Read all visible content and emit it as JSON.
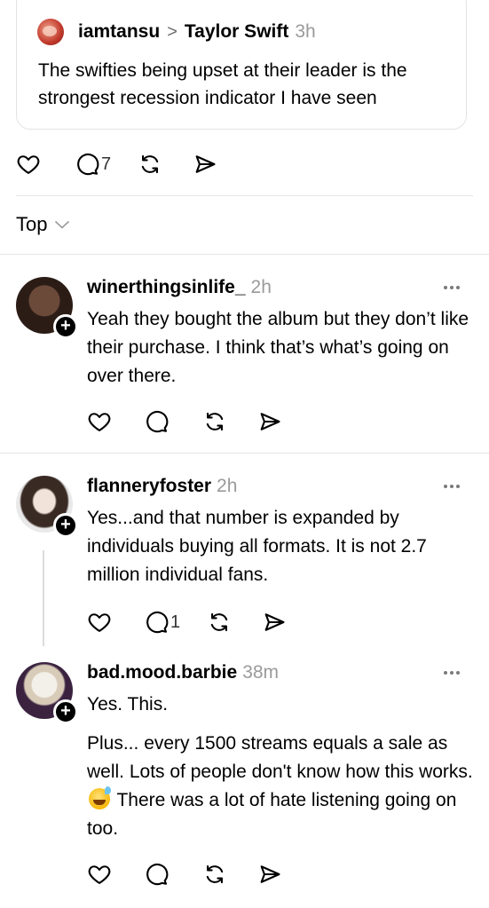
{
  "quote": {
    "username": "iamtansu",
    "separator": ">",
    "target": "Taylor Swift",
    "time": "3h",
    "text": "The swifties being upset at their leader is the strongest recession indicator I have seen"
  },
  "main_actions": {
    "replies_count": "7"
  },
  "sort": {
    "label": "Top"
  },
  "replies": [
    {
      "username": "winerthingsinlife_",
      "time": "2h",
      "text": "Yeah they bought the album but they don’t like their purchase. I think that’s what’s going on over there.",
      "replies_count": ""
    },
    {
      "username": "flanneryfoster",
      "time": "2h",
      "text": "Yes...and that number is expanded by individuals buying all formats. It is not 2.7 million individual fans.",
      "replies_count": "1"
    },
    {
      "username": "bad.mood.barbie",
      "time": "38m",
      "text_line1": "Yes. This.",
      "text_p2_a": "Plus... every 1500 streams equals a sale as well. Lots of people don't know how this works.",
      "text_p2_b": "There was a lot of hate listening going on too.",
      "emoji": "sweat-smile-emoji",
      "replies_count": ""
    }
  ],
  "icons": {
    "like": "heart-icon",
    "reply": "speech-bubble-icon",
    "repost": "repost-icon",
    "share": "send-icon",
    "more": "more-dots-icon",
    "follow": "plus-icon",
    "chevron": "chevron-down-icon"
  }
}
